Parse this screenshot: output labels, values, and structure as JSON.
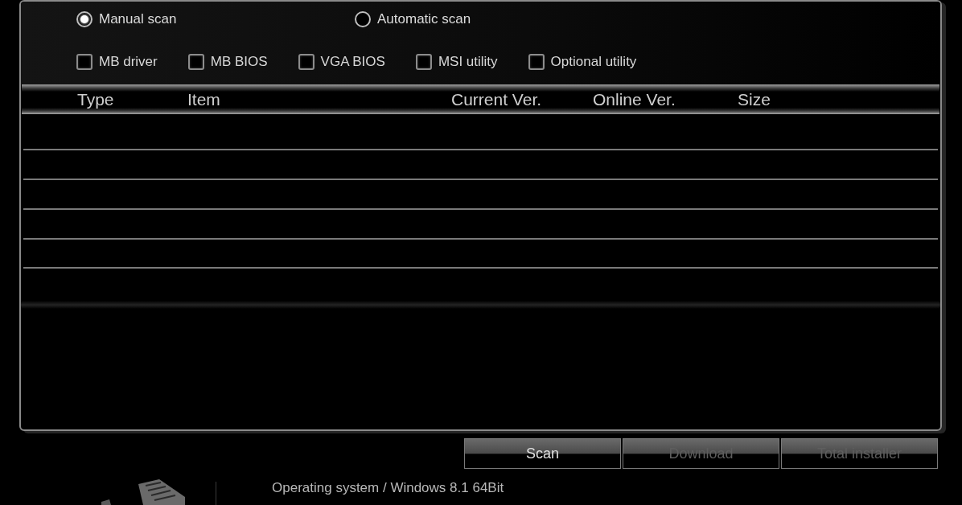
{
  "scan_modes": [
    {
      "label": "Manual scan",
      "selected": true
    },
    {
      "label": "Automatic scan",
      "selected": false
    }
  ],
  "categories": [
    {
      "label": "MB driver",
      "checked": false
    },
    {
      "label": "MB BIOS",
      "checked": false
    },
    {
      "label": "VGA BIOS",
      "checked": false
    },
    {
      "label": "MSI utility",
      "checked": false
    },
    {
      "label": "Optional utility",
      "checked": false
    }
  ],
  "table": {
    "columns": [
      "Type",
      "Item",
      "Current Ver.",
      "Online Ver.",
      "Size"
    ]
  },
  "buttons": [
    {
      "label": "Scan",
      "disabled": false
    },
    {
      "label": "Download",
      "disabled": true
    },
    {
      "label": "Total installer",
      "disabled": true
    }
  ],
  "system_info": "Operating system / Windows 8.1 64Bit"
}
